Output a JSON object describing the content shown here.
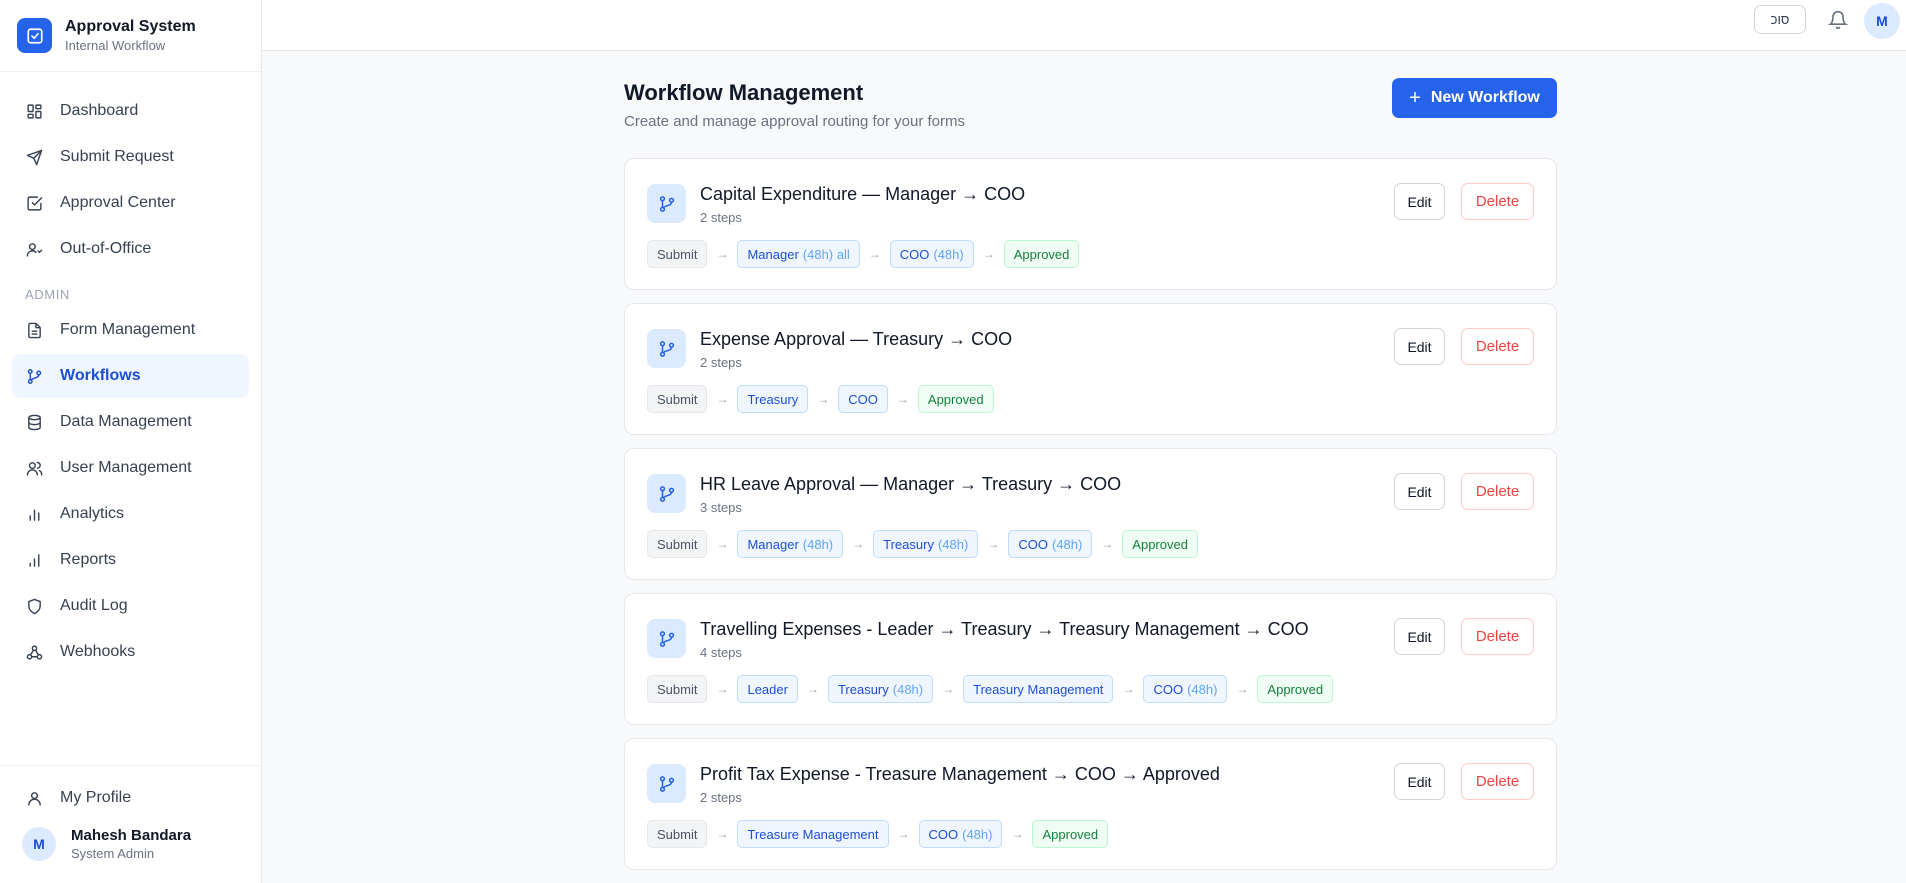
{
  "brand": {
    "title": "Approval System",
    "subtitle": "Internal Workflow"
  },
  "nav": {
    "dashboard": "Dashboard",
    "submit": "Submit Request",
    "approval_center": "Approval Center",
    "ooo": "Out-of-Office",
    "admin_section": "ADMIN",
    "forms": "Form Management",
    "workflows": "Workflows",
    "data": "Data Management",
    "users": "User Management",
    "analytics": "Analytics",
    "reports": "Reports",
    "audit": "Audit Log",
    "webhooks": "Webhooks",
    "profile": "My Profile"
  },
  "user": {
    "initial": "M",
    "name": "Mahesh Bandara",
    "role": "System Admin"
  },
  "topbar": {
    "lang": "סוכ",
    "avatar": "M"
  },
  "page": {
    "title": "Workflow Management",
    "subtitle": "Create and manage approval routing for your forms",
    "new_button": "New Workflow"
  },
  "labels": {
    "edit": "Edit",
    "delete": "Delete",
    "submit": "Submit",
    "approved": "Approved"
  },
  "workflows": [
    {
      "name": "Capital Expenditure — Manager → COO",
      "steps_label": "2 steps",
      "steps": [
        {
          "role": "Manager",
          "sla": "(48h) all"
        },
        {
          "role": "COO",
          "sla": "(48h)"
        }
      ]
    },
    {
      "name": "Expense Approval — Treasury → COO",
      "steps_label": "2 steps",
      "steps": [
        {
          "role": "Treasury",
          "sla": ""
        },
        {
          "role": "COO",
          "sla": ""
        }
      ]
    },
    {
      "name": "HR Leave Approval — Manager → Treasury → COO",
      "steps_label": "3 steps",
      "steps": [
        {
          "role": "Manager",
          "sla": "(48h)"
        },
        {
          "role": "Treasury",
          "sla": "(48h)"
        },
        {
          "role": "COO",
          "sla": "(48h)"
        }
      ]
    },
    {
      "name": "Travelling Expenses - Leader → Treasury → Treasury Management → COO",
      "steps_label": "4 steps",
      "steps": [
        {
          "role": "Leader",
          "sla": ""
        },
        {
          "role": "Treasury",
          "sla": "(48h)"
        },
        {
          "role": "Treasury Management",
          "sla": ""
        },
        {
          "role": "COO",
          "sla": "(48h)"
        }
      ]
    },
    {
      "name": "Profit Tax Expense - Treasure Management → COO → Approved",
      "steps_label": "2 steps",
      "steps": [
        {
          "role": "Treasure Management",
          "sla": ""
        },
        {
          "role": "COO",
          "sla": "(48h)"
        }
      ]
    }
  ],
  "colors": {
    "accent": "#2563eb",
    "danger": "#ef4444",
    "success": "#15803d"
  }
}
